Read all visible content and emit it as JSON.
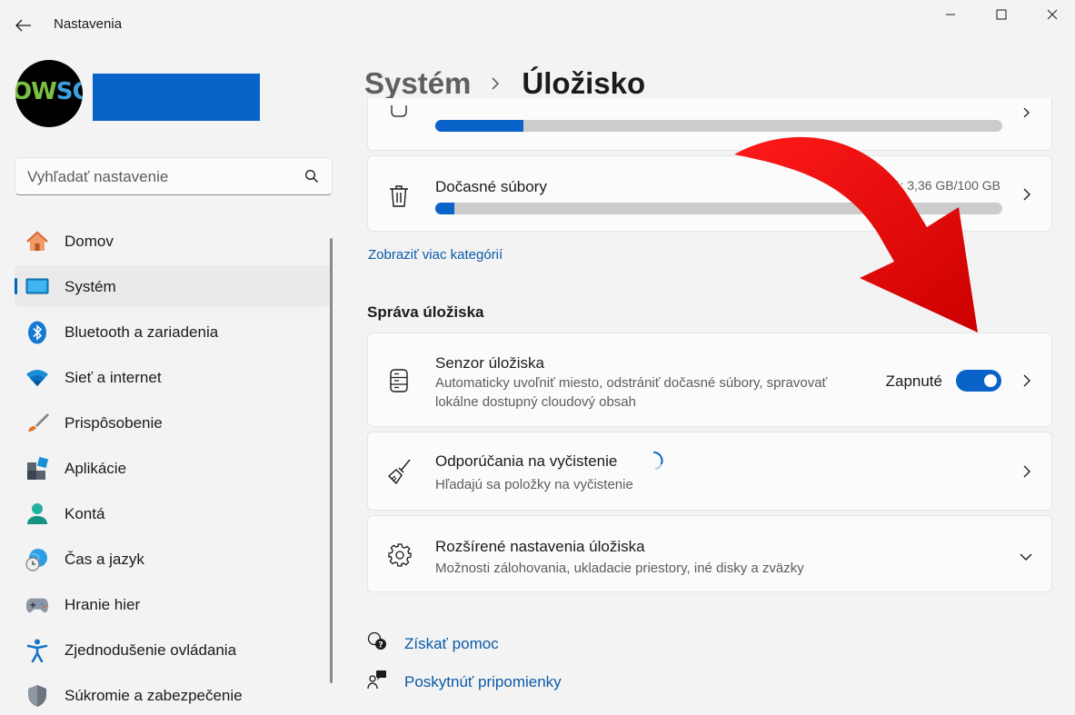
{
  "window": {
    "title": "Nastavenia",
    "controls": {
      "minimize": "minimize",
      "maximize": "maximize",
      "close": "close"
    }
  },
  "sidebar": {
    "avatar_text": "OWSC",
    "search_placeholder": "Vyhľadať nastavenie",
    "items": [
      {
        "label": "Domov",
        "icon": "home-icon"
      },
      {
        "label": "Systém",
        "icon": "system-display-icon",
        "active": true
      },
      {
        "label": "Bluetooth a zariadenia",
        "icon": "bluetooth-icon"
      },
      {
        "label": "Sieť a internet",
        "icon": "wifi-icon"
      },
      {
        "label": "Prispôsobenie",
        "icon": "paintbrush-icon"
      },
      {
        "label": "Aplikácie",
        "icon": "apps-icon"
      },
      {
        "label": "Kontá",
        "icon": "account-icon"
      },
      {
        "label": "Čas a jazyk",
        "icon": "globe-clock-icon"
      },
      {
        "label": "Hranie hier",
        "icon": "gamepad-icon"
      },
      {
        "label": "Zjednodušenie ovládania",
        "icon": "accessibility-icon"
      },
      {
        "label": "Súkromie a zabezpečenie",
        "icon": "shield-icon"
      }
    ]
  },
  "breadcrumb": {
    "parent": "Systém",
    "current": "Úložisko"
  },
  "storage": {
    "partial_card": {
      "progress": 0.155
    },
    "temp_files": {
      "title": "Dočasné súbory",
      "meta": "ité: 3,36 GB/100 GB",
      "progress": 0.033
    },
    "more_categories_link": "Zobraziť viac kategórií"
  },
  "management": {
    "section_title": "Správa úložiska",
    "sensor": {
      "title": "Senzor úložiska",
      "desc_line1": "Automaticky uvoľniť miesto, odstrániť dočasné súbory, spravovať",
      "desc_line2": "lokálne dostupný cloudový obsah",
      "state_label": "Zapnuté",
      "enabled": true
    },
    "cleanup": {
      "title": "Odporúčania na vyčistenie",
      "desc": "Hľadajú sa položky na vyčistenie"
    },
    "advanced": {
      "title": "Rozšírené nastavenia úložiska",
      "desc": "Možnosti zálohovania, ukladacie priestory, iné disky a zväzky"
    }
  },
  "help": {
    "get_help": "Získať pomoc",
    "feedback": "Poskytnúť pripomienky"
  },
  "colors": {
    "accent": "#0a63c9",
    "arrow": "#e8000b",
    "background": "#f3f3f3"
  }
}
